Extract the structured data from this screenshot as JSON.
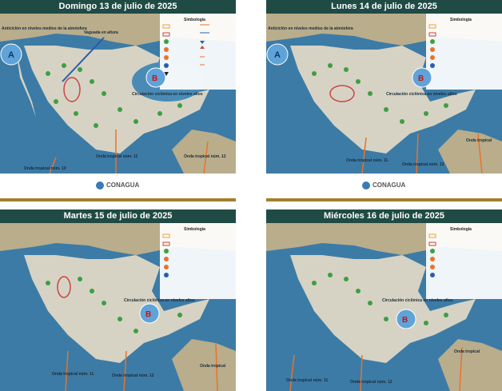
{
  "panels": [
    {
      "title": "Domingo 13 de julio de 2025",
      "legend_title": "Simbología",
      "labels": {
        "anticyclone": "Anticiclón en niveles medios de la atmósfera",
        "trough": "Vaguada en altura",
        "cyclonic": "Circulación ciclónica en niveles altos",
        "wave_a": "Onda tropical núm. 11",
        "wave_b": "Onda tropical núm. 12",
        "wave_c": "Onda tropical núm. 10"
      },
      "footer_logo": "CONAGUA"
    },
    {
      "title": "Lunes  14 de julio de 2025",
      "legend_title": "Simbología",
      "labels": {
        "anticyclone": "Anticiclón en niveles medios de la atmósfera",
        "cyclonic": "Circulación ciclónica en niveles altos",
        "wave_a": "Onda tropical núm. 11",
        "wave_b": "Onda tropical núm. 12",
        "wave_d": "Onda tropical"
      },
      "footer_logo": "CONAGUA"
    },
    {
      "title": "Martes 15 de julio de 2025",
      "legend_title": "Simbología",
      "labels": {
        "cyclonic": "Circulación ciclónica en niveles altos",
        "wave_a": "Onda tropical núm. 11",
        "wave_b": "Onda tropical núm. 12",
        "wave_d": "Onda tropical"
      }
    },
    {
      "title": "Miércoles 16 de julio de 2025",
      "legend_title": "Simbología",
      "labels": {
        "cyclonic": "Circulación ciclónica en niveles altos",
        "wave_a": "Onda tropical núm. 11",
        "wave_b": "Onda tropical núm. 12",
        "wave_d": "Onda tropical"
      }
    }
  ],
  "colors": {
    "header": "#1f4b44",
    "gold": "#a57f2c",
    "ocean": "#3c7ba6",
    "land": "#b9ad8c",
    "mexico": "#d6d3c4",
    "tropical_wave": "#e8732a",
    "rain_icon": "#3f9e42"
  }
}
